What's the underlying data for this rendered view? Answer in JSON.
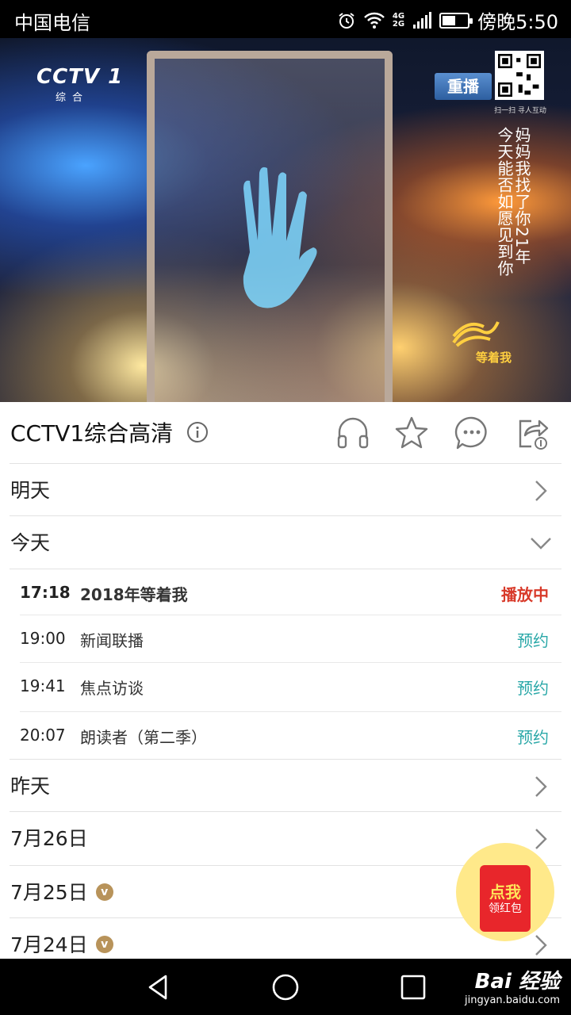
{
  "status_bar": {
    "carrier": "中国电信",
    "network_top": "4G",
    "network_bottom": "2G",
    "time": "傍晚5:50",
    "battery_level": 0.6
  },
  "video": {
    "channel_logo": "CCTV 1",
    "channel_logo_sub": "综合",
    "badge": "重播",
    "qr_caption": "扫一扫  寻人互动",
    "caption_right": "妈妈我找了你21年",
    "caption_left": "今天能否如愿见到你",
    "show_logo": "等着我"
  },
  "header": {
    "channel_title": "CCTV1综合高清",
    "actions": [
      "headphones-icon",
      "star-icon",
      "comment-icon",
      "share-icon"
    ]
  },
  "days": {
    "tomorrow": "明天",
    "today": "今天",
    "yesterday": "昨天",
    "d0726": "7月26日",
    "d0725": "7月25日",
    "d0724": "7月24日",
    "vip_mark": "v"
  },
  "programs": [
    {
      "time": "17:18",
      "title": "2018年等着我",
      "status": "播放中"
    },
    {
      "time": "19:00",
      "title": "新闻联播",
      "status": "预约"
    },
    {
      "time": "19:41",
      "title": "焦点访谈",
      "status": "预约"
    },
    {
      "time": "20:07",
      "title": "朗读者（第二季）",
      "status": "预约"
    }
  ],
  "red_envelope": {
    "line1": "点我",
    "line2": "领红包"
  },
  "watermark": {
    "main": "Bai 经验",
    "sub": "jingyan.baidu.com"
  },
  "colors": {
    "live": "#d83a2a",
    "reserve": "#2aa8a8"
  }
}
